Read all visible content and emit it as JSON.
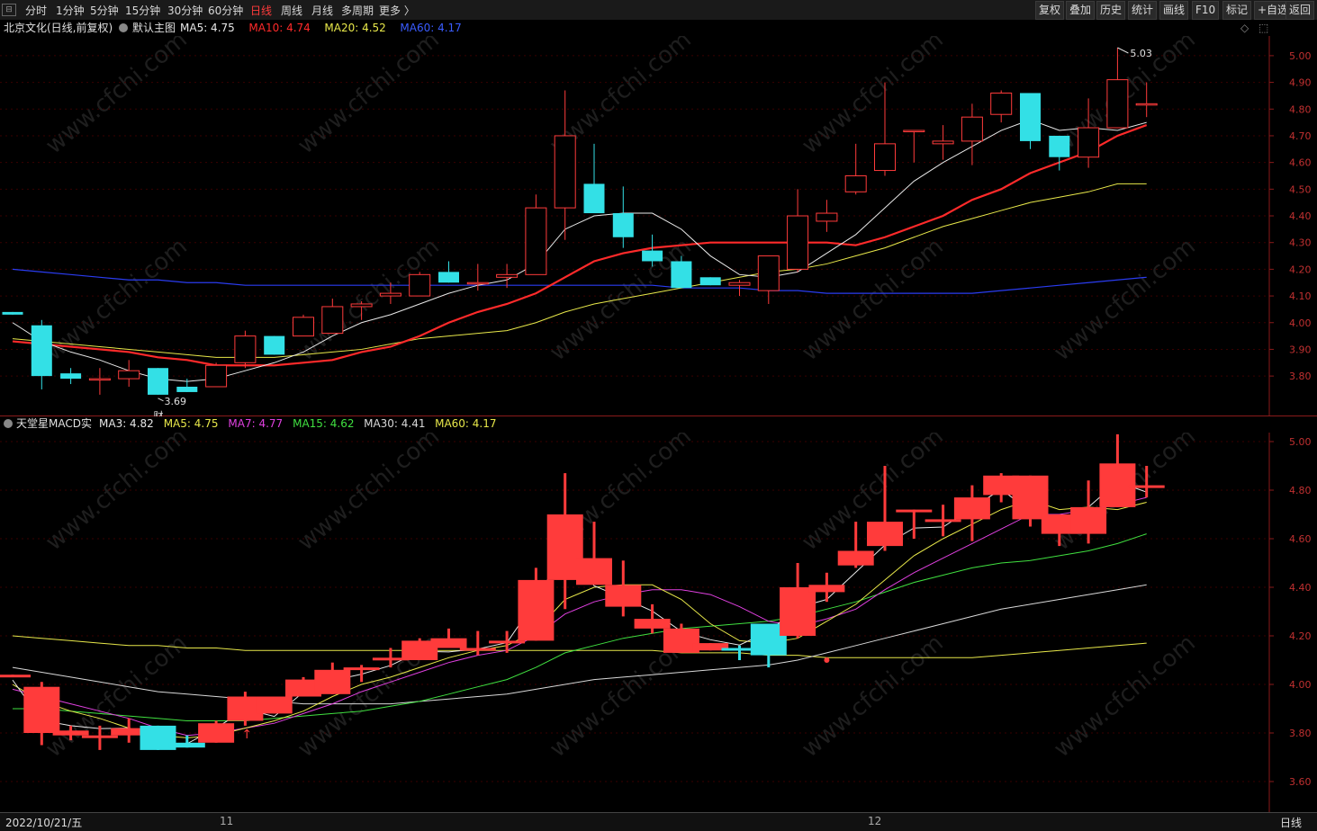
{
  "toolbar": {
    "periods": [
      "分时",
      "1分钟",
      "5分钟",
      "15分钟",
      "30分钟",
      "60分钟",
      "日线",
      "周线",
      "月线",
      "多周期",
      "更多 〉"
    ],
    "active_period": "日线",
    "right_buttons": [
      "复权",
      "叠加",
      "历史",
      "统计",
      "画线",
      "F10",
      "标记",
      "+自选",
      "返回"
    ]
  },
  "main_chart": {
    "stock_title": "北京文化(日线,前复权)",
    "template": "默认主图",
    "ma_labels": [
      {
        "text": "MA5: 4.75",
        "color": "#e8e8e8"
      },
      {
        "text": "MA10: 4.74",
        "color": "#ff2a2a"
      },
      {
        "text": "MA20: 4.52",
        "color": "#e8e84a"
      },
      {
        "text": "MA60: 4.17",
        "color": "#3a5cff"
      }
    ],
    "high_label": "5.03",
    "low_label": "3.69",
    "event_mark": "财",
    "y_ticks": [
      "5.00",
      "4.90",
      "4.80",
      "4.70",
      "4.60",
      "4.50",
      "4.40",
      "4.30",
      "4.20",
      "4.10",
      "4.00",
      "3.90",
      "3.80"
    ]
  },
  "indicator_chart": {
    "title": "天堂星MACD实",
    "ma_labels": [
      {
        "text": "MA3: 4.82",
        "color": "#e8e8e8"
      },
      {
        "text": "MA5: 4.75",
        "color": "#e8e84a"
      },
      {
        "text": "MA7: 4.77",
        "color": "#e040e0"
      },
      {
        "text": "MA15: 4.62",
        "color": "#40e040"
      },
      {
        "text": "MA30: 4.41",
        "color": "#d8d8d8"
      },
      {
        "text": "MA60: 4.17",
        "color": "#e8e84a"
      }
    ],
    "y_ticks": [
      "5.00",
      "4.80",
      "4.60",
      "4.40",
      "4.20",
      "4.00",
      "3.80",
      "3.60"
    ]
  },
  "x_axis": {
    "start_label": "2022/10/21/五",
    "ticks": [
      "11",
      "12"
    ],
    "period_label": "日线"
  },
  "watermark": "www.cfchi.com",
  "colors": {
    "up": "#ff3b3b",
    "down": "#33e0e6",
    "bg": "#000000"
  },
  "chart_data": {
    "type": "candlestick",
    "ohlc": [
      [
        4.04,
        4.03,
        4.04,
        4.03
      ],
      [
        3.99,
        4.01,
        3.75,
        3.8
      ],
      [
        3.81,
        3.83,
        3.77,
        3.79
      ],
      [
        3.79,
        3.83,
        3.73,
        3.79
      ],
      [
        3.79,
        3.86,
        3.76,
        3.82
      ],
      [
        3.83,
        3.83,
        3.73,
        3.73
      ],
      [
        3.76,
        3.79,
        3.74,
        3.74
      ],
      [
        3.76,
        3.85,
        3.76,
        3.84
      ],
      [
        3.85,
        3.97,
        3.83,
        3.95
      ],
      [
        3.95,
        3.95,
        3.88,
        3.88
      ],
      [
        3.95,
        4.03,
        3.95,
        4.02
      ],
      [
        3.96,
        4.09,
        3.96,
        4.06
      ],
      [
        4.06,
        4.08,
        4.01,
        4.07
      ],
      [
        4.1,
        4.15,
        4.07,
        4.11
      ],
      [
        4.1,
        4.19,
        4.1,
        4.18
      ],
      [
        4.19,
        4.23,
        4.15,
        4.15
      ],
      [
        4.15,
        4.22,
        4.12,
        4.15
      ],
      [
        4.17,
        4.22,
        4.13,
        4.18
      ],
      [
        4.18,
        4.48,
        4.18,
        4.43
      ],
      [
        4.43,
        4.87,
        4.31,
        4.7
      ],
      [
        4.52,
        4.67,
        4.41,
        4.41
      ],
      [
        4.41,
        4.51,
        4.28,
        4.32
      ],
      [
        4.27,
        4.33,
        4.21,
        4.23
      ],
      [
        4.23,
        4.25,
        4.15,
        4.13
      ],
      [
        4.17,
        4.17,
        4.14,
        4.14
      ],
      [
        4.14,
        4.16,
        4.1,
        4.15
      ],
      [
        4.12,
        4.22,
        4.07,
        4.25
      ],
      [
        4.2,
        4.5,
        4.19,
        4.4
      ],
      [
        4.38,
        4.46,
        4.34,
        4.41
      ],
      [
        4.49,
        4.67,
        4.48,
        4.55
      ],
      [
        4.57,
        4.9,
        4.55,
        4.67
      ],
      [
        4.72,
        4.72,
        4.6,
        4.72
      ],
      [
        4.67,
        4.74,
        4.61,
        4.68
      ],
      [
        4.68,
        4.82,
        4.59,
        4.77
      ],
      [
        4.78,
        4.87,
        4.75,
        4.86
      ],
      [
        4.86,
        4.86,
        4.65,
        4.68
      ],
      [
        4.7,
        4.7,
        4.57,
        4.62
      ],
      [
        4.62,
        4.84,
        4.58,
        4.73
      ],
      [
        4.73,
        5.03,
        4.73,
        4.91
      ],
      [
        4.82,
        4.9,
        4.77,
        4.82
      ]
    ],
    "ma5": [
      4.0,
      3.93,
      3.89,
      3.86,
      3.82,
      3.79,
      3.78,
      3.79,
      3.82,
      3.85,
      3.89,
      3.95,
      4.0,
      4.03,
      4.07,
      4.11,
      4.14,
      4.16,
      4.22,
      4.35,
      4.4,
      4.41,
      4.41,
      4.35,
      4.25,
      4.18,
      4.17,
      4.19,
      4.26,
      4.33,
      4.43,
      4.53,
      4.6,
      4.66,
      4.72,
      4.76,
      4.72,
      4.73,
      4.72,
      4.75
    ],
    "ma10": [
      3.93,
      3.92,
      3.91,
      3.9,
      3.89,
      3.87,
      3.86,
      3.84,
      3.84,
      3.84,
      3.85,
      3.86,
      3.89,
      3.91,
      3.95,
      4.0,
      4.04,
      4.07,
      4.11,
      4.17,
      4.23,
      4.26,
      4.28,
      4.29,
      4.3,
      4.3,
      4.3,
      4.3,
      4.3,
      4.29,
      4.32,
      4.36,
      4.4,
      4.46,
      4.5,
      4.56,
      4.6,
      4.64,
      4.7,
      4.74
    ],
    "ma20": [
      3.94,
      3.93,
      3.92,
      3.91,
      3.9,
      3.89,
      3.88,
      3.87,
      3.87,
      3.87,
      3.88,
      3.89,
      3.9,
      3.92,
      3.94,
      3.95,
      3.96,
      3.97,
      4.0,
      4.04,
      4.07,
      4.09,
      4.11,
      4.13,
      4.15,
      4.17,
      4.19,
      4.2,
      4.22,
      4.25,
      4.28,
      4.32,
      4.36,
      4.39,
      4.42,
      4.45,
      4.47,
      4.49,
      4.52,
      4.52
    ],
    "ma60": [
      4.2,
      4.19,
      4.18,
      4.17,
      4.16,
      4.16,
      4.15,
      4.15,
      4.14,
      4.14,
      4.14,
      4.14,
      4.14,
      4.14,
      4.14,
      4.14,
      4.14,
      4.14,
      4.14,
      4.14,
      4.14,
      4.14,
      4.14,
      4.13,
      4.13,
      4.13,
      4.12,
      4.12,
      4.11,
      4.11,
      4.11,
      4.11,
      4.11,
      4.11,
      4.12,
      4.13,
      4.14,
      4.15,
      4.16,
      4.17
    ],
    "ind_ma7": [
      3.98,
      3.95,
      3.92,
      3.89,
      3.86,
      3.82,
      3.79,
      3.8,
      3.82,
      3.84,
      3.88,
      3.92,
      3.97,
      4.01,
      4.05,
      4.09,
      4.12,
      4.14,
      4.2,
      4.29,
      4.34,
      4.37,
      4.39,
      4.39,
      4.37,
      4.32,
      4.26,
      4.24,
      4.27,
      4.31,
      4.39,
      4.46,
      4.52,
      4.58,
      4.64,
      4.7,
      4.7,
      4.72,
      4.74,
      4.77
    ],
    "ind_ma15": [
      3.9,
      3.9,
      3.89,
      3.88,
      3.87,
      3.86,
      3.85,
      3.85,
      3.85,
      3.86,
      3.87,
      3.88,
      3.89,
      3.91,
      3.93,
      3.96,
      3.99,
      4.02,
      4.07,
      4.13,
      4.16,
      4.19,
      4.21,
      4.23,
      4.24,
      4.25,
      4.26,
      4.28,
      4.31,
      4.34,
      4.38,
      4.42,
      4.45,
      4.48,
      4.5,
      4.51,
      4.53,
      4.55,
      4.58,
      4.62
    ],
    "ind_ma30": [
      4.07,
      4.05,
      4.03,
      4.01,
      3.99,
      3.97,
      3.96,
      3.95,
      3.94,
      3.93,
      3.92,
      3.92,
      3.92,
      3.92,
      3.93,
      3.94,
      3.95,
      3.96,
      3.98,
      4.0,
      4.02,
      4.03,
      4.04,
      4.05,
      4.06,
      4.07,
      4.08,
      4.1,
      4.13,
      4.16,
      4.19,
      4.22,
      4.25,
      4.28,
      4.31,
      4.33,
      4.35,
      4.37,
      4.39,
      4.41
    ]
  }
}
